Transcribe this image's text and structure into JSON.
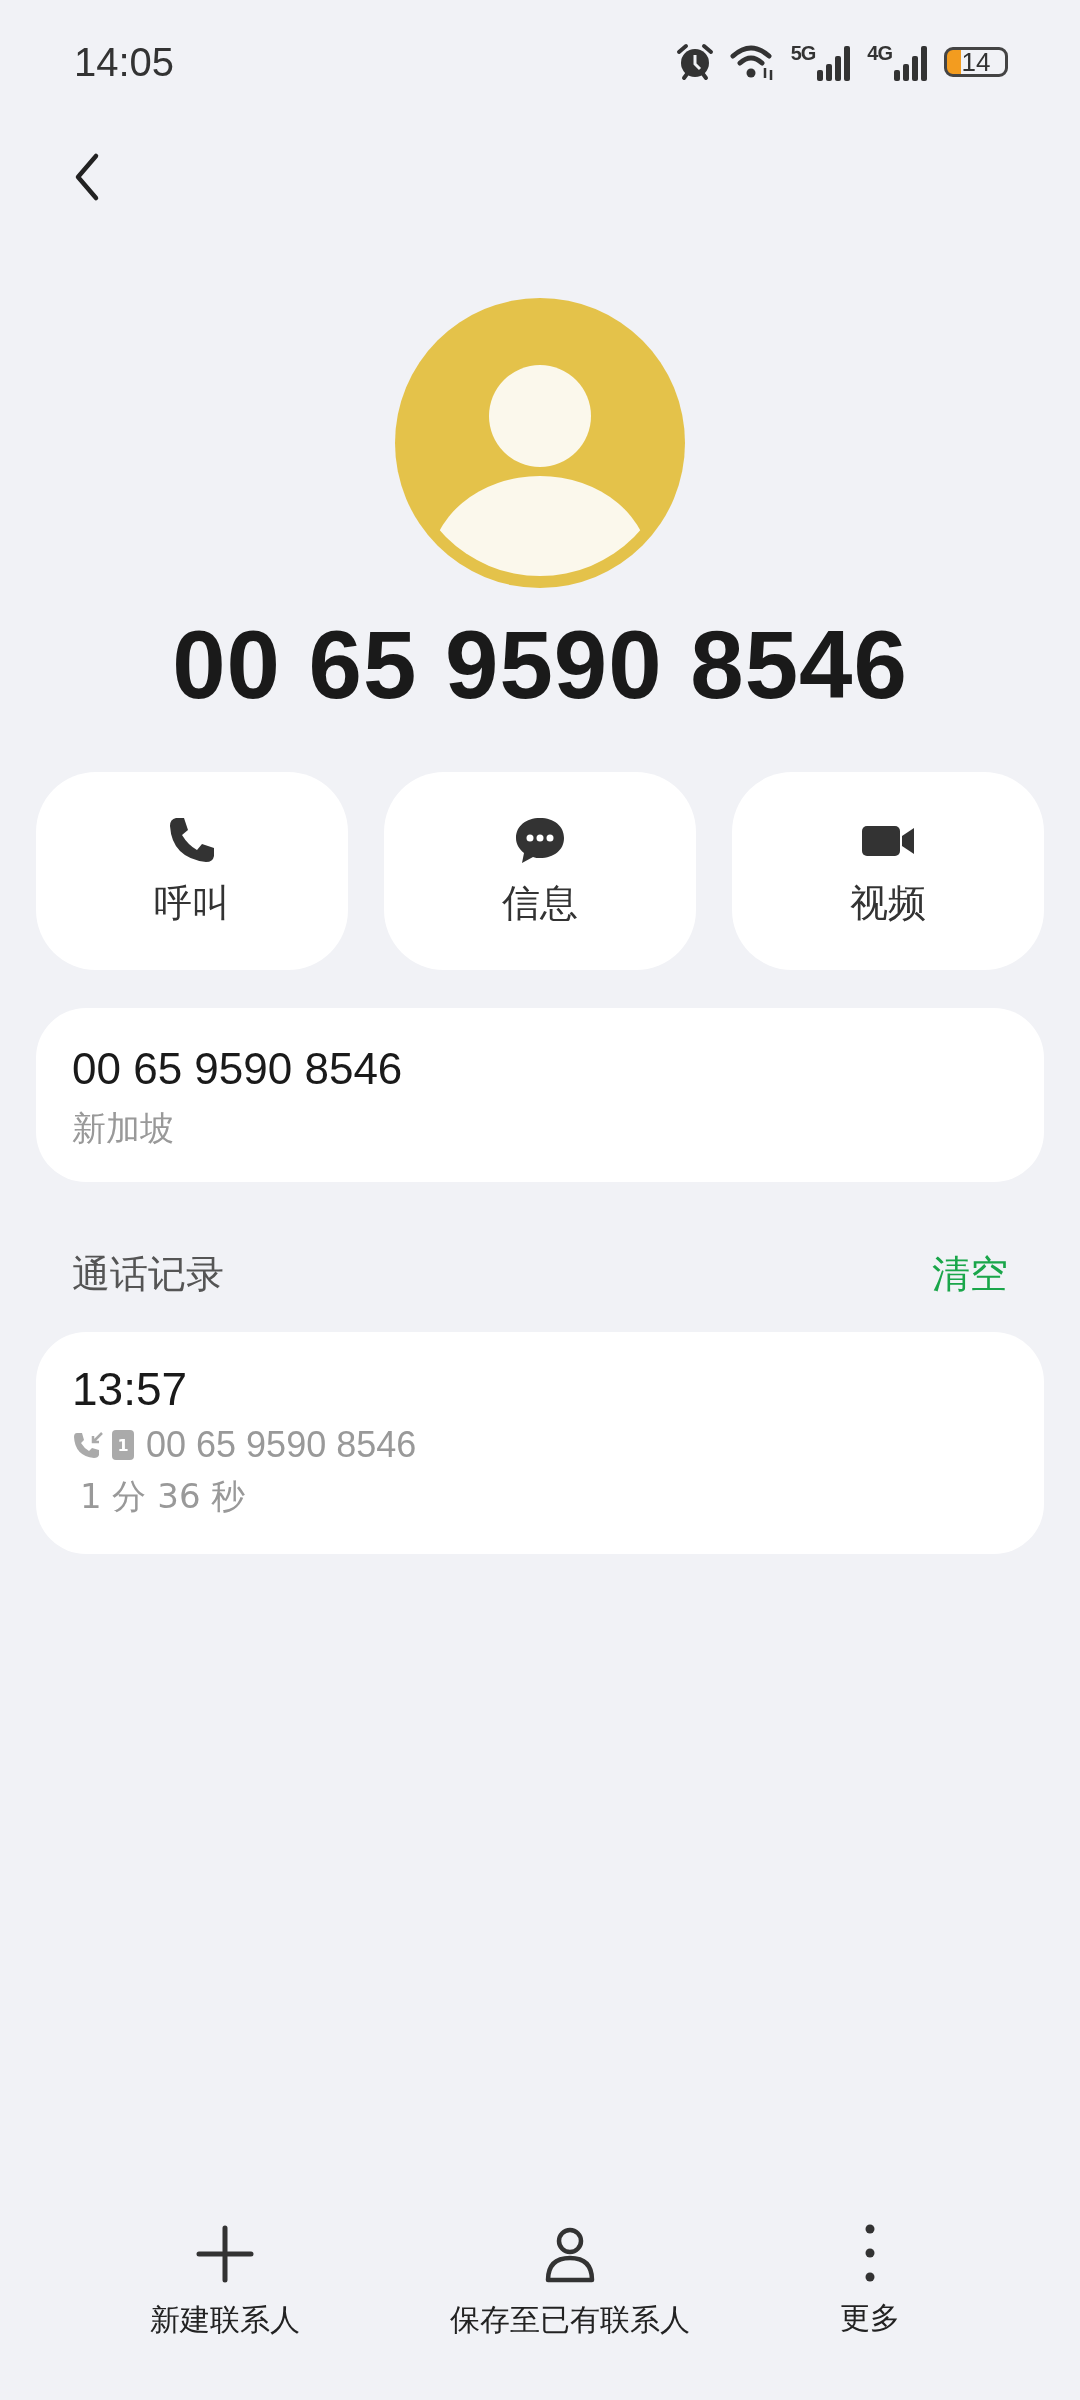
{
  "status_bar": {
    "time": "14:05",
    "network_1": "5G",
    "network_2": "4G",
    "battery": "14"
  },
  "contact": {
    "name": "00 65 9590 8546"
  },
  "actions": [
    {
      "kind": "call",
      "label": "呼叫"
    },
    {
      "kind": "message",
      "label": "信息"
    },
    {
      "kind": "video",
      "label": "视频"
    }
  ],
  "number_card": {
    "number": "00 65 9590 8546",
    "location": "新加坡"
  },
  "call_log": {
    "title": "通话记录",
    "clear": "清空",
    "entries": [
      {
        "time": "13:57",
        "number": "00 65 9590 8546",
        "sim": "1",
        "duration": "1 分 36 秒"
      }
    ]
  },
  "bottom_bar": [
    {
      "kind": "add",
      "label": "新建联系人"
    },
    {
      "kind": "person",
      "label": "保存至已有联系人"
    },
    {
      "kind": "more",
      "label": "更多"
    }
  ]
}
